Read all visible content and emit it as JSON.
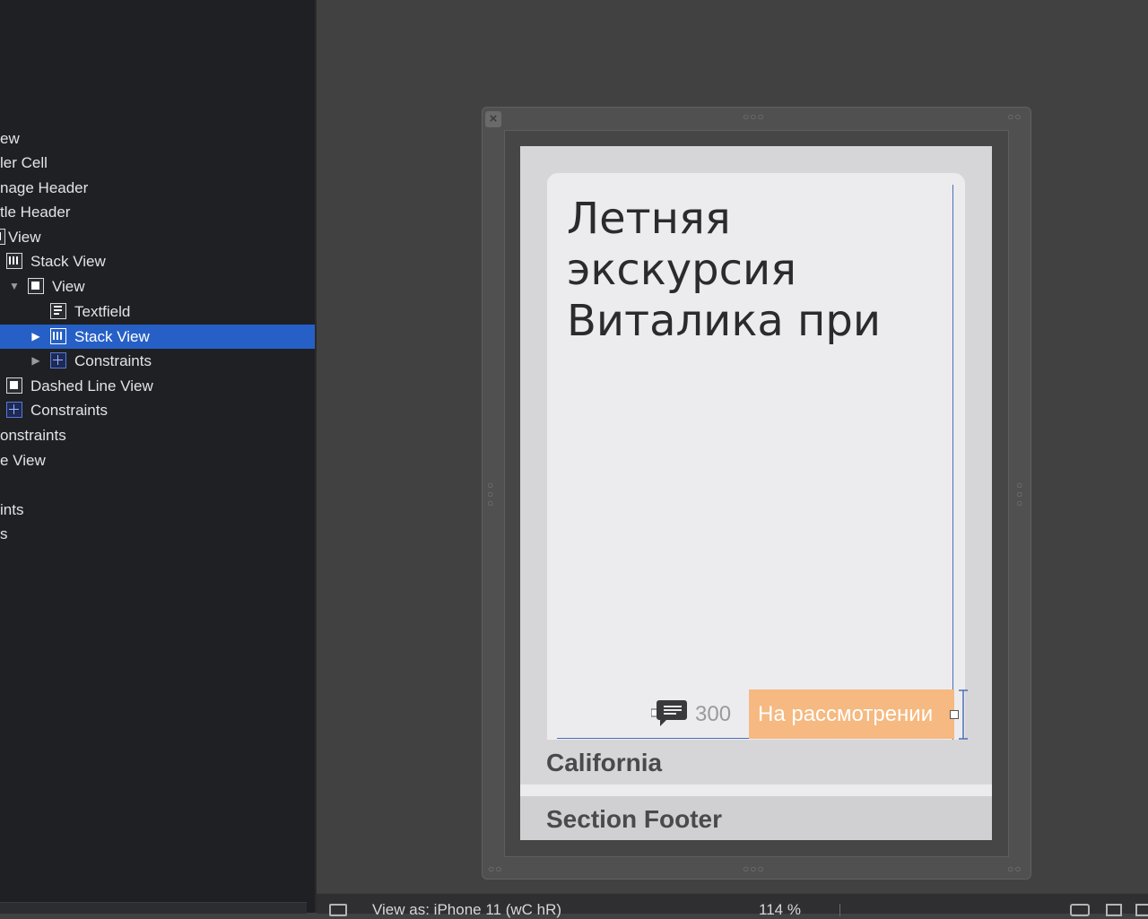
{
  "outline": {
    "items": [
      {
        "label": "ew"
      },
      {
        "label": "ler Cell"
      },
      {
        "label": "nage Header"
      },
      {
        "label": "tle Header"
      },
      {
        "label": "View"
      },
      {
        "label": "Stack View"
      },
      {
        "label": "View"
      },
      {
        "label": "Textfield"
      },
      {
        "label": "Stack View"
      },
      {
        "label": "Constraints"
      },
      {
        "label": "Dashed Line View"
      },
      {
        "label": "Constraints"
      },
      {
        "label": "onstraints"
      },
      {
        "label": "e View"
      },
      {
        "label": "ints"
      },
      {
        "label": "s"
      }
    ]
  },
  "canvas": {
    "card_title": "Летняя экскурсия Виталика при",
    "comment_count": "300",
    "status": "На рассмотрении",
    "section_header": "California",
    "section_footer": "Section Footer",
    "accent_color": "#f5b981",
    "selection_color": "#2660c7"
  },
  "bottom_bar": {
    "view_as": "View as: iPhone 11 (wC hR)",
    "zoom": "114 %"
  }
}
